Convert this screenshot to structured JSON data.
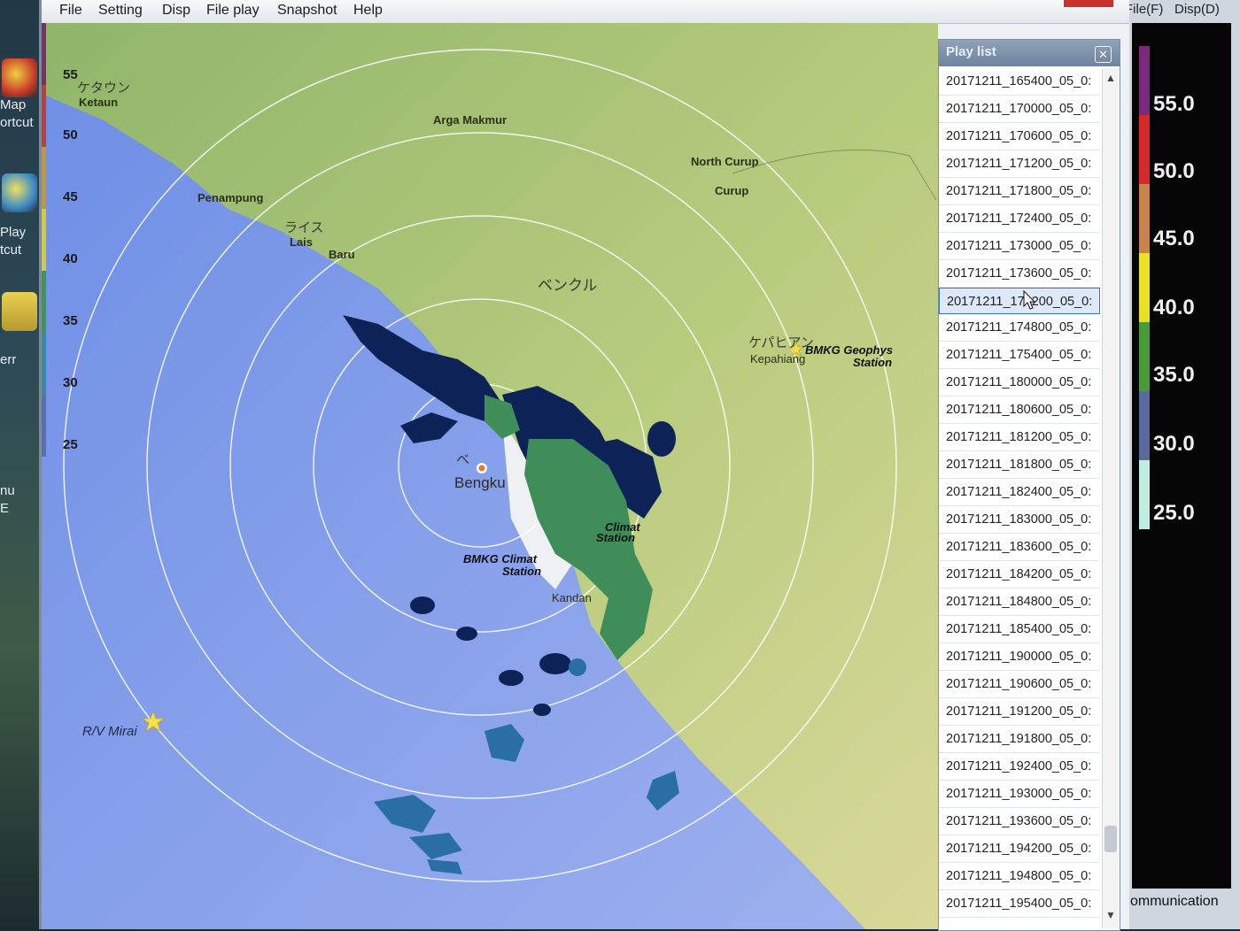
{
  "desktop": {
    "labels": [
      "Map",
      "ortcut",
      "Play",
      "tcut",
      "err",
      "nu",
      "E"
    ]
  },
  "menubar": {
    "items": [
      "File",
      "Setting",
      "Disp",
      "File play",
      "Snapshot",
      "Help"
    ]
  },
  "map": {
    "legend_values": [
      "55",
      "50",
      "45",
      "40",
      "35",
      "30",
      "25"
    ],
    "legend_colors": [
      "#7a2e6a",
      "#c53a3a",
      "#c9962e",
      "#d7cc2c",
      "#3a9a4a",
      "#2f8f9f",
      "#5a6fb0"
    ],
    "places": {
      "ketaun_jp": "ケタウン",
      "ketaun": "Ketaun",
      "arga_makmur": "Arga Makmur",
      "north_curup": "North Curup",
      "curup": "Curup",
      "penampung": "Penampung",
      "lais_jp": "ライス",
      "lais": "Lais",
      "baru": "Baru",
      "bengkulu_jp": "ベンクル",
      "kepahiang_jp": "ケパヒアン",
      "kepahiang": "Kepahiang",
      "bengkulu_jp_small": "ベ",
      "bengkulu": "Bengku",
      "kandan": "Kandan",
      "rv_mirai": "R/V Mirai"
    },
    "stations": {
      "geophys_line1": "BMKG Geophys",
      "geophys_line2": "Station",
      "climat_line1": "BMKG Climat",
      "climat_line2": "Station",
      "climat_small_line1": "Climat",
      "climat_small_line2": "Station"
    }
  },
  "playlist": {
    "title": "Play list",
    "close_glyph": "✕",
    "items": [
      "20171211_165400_05_0:",
      "20171211_170000_05_0:",
      "20171211_170600_05_0:",
      "20171211_171200_05_0:",
      "20171211_171800_05_0:",
      "20171211_172400_05_0:",
      "20171211_173000_05_0:",
      "20171211_173600_05_0:",
      "20171211_174200_05_0:",
      "20171211_174800_05_0:",
      "20171211_175400_05_0:",
      "20171211_180000_05_0:",
      "20171211_180600_05_0:",
      "20171211_181200_05_0:",
      "20171211_181800_05_0:",
      "20171211_182400_05_0:",
      "20171211_183000_05_0:",
      "20171211_183600_05_0:",
      "20171211_184200_05_0:",
      "20171211_184800_05_0:",
      "20171211_185400_05_0:",
      "20171211_190000_05_0:",
      "20171211_190600_05_0:",
      "20171211_191200_05_0:",
      "20171211_191800_05_0:",
      "20171211_192400_05_0:",
      "20171211_193000_05_0:",
      "20171211_193600_05_0:",
      "20171211_194200_05_0:",
      "20171211_194800_05_0:",
      "20171211_195400_05_0:"
    ],
    "selected_index": 8
  },
  "right_window": {
    "menu": [
      "File(F)",
      "Disp(D)"
    ],
    "scale_values": [
      "55.0",
      "50.0",
      "45.0",
      "40.0",
      "35.0",
      "30.0",
      "25.0"
    ],
    "scale_colors": [
      "#7a2a7a",
      "#d42a2a",
      "#c8824a",
      "#e8e020",
      "#4a9a3a",
      "#5a6a9a",
      "#bfeee0"
    ],
    "footer": "ommunication"
  }
}
